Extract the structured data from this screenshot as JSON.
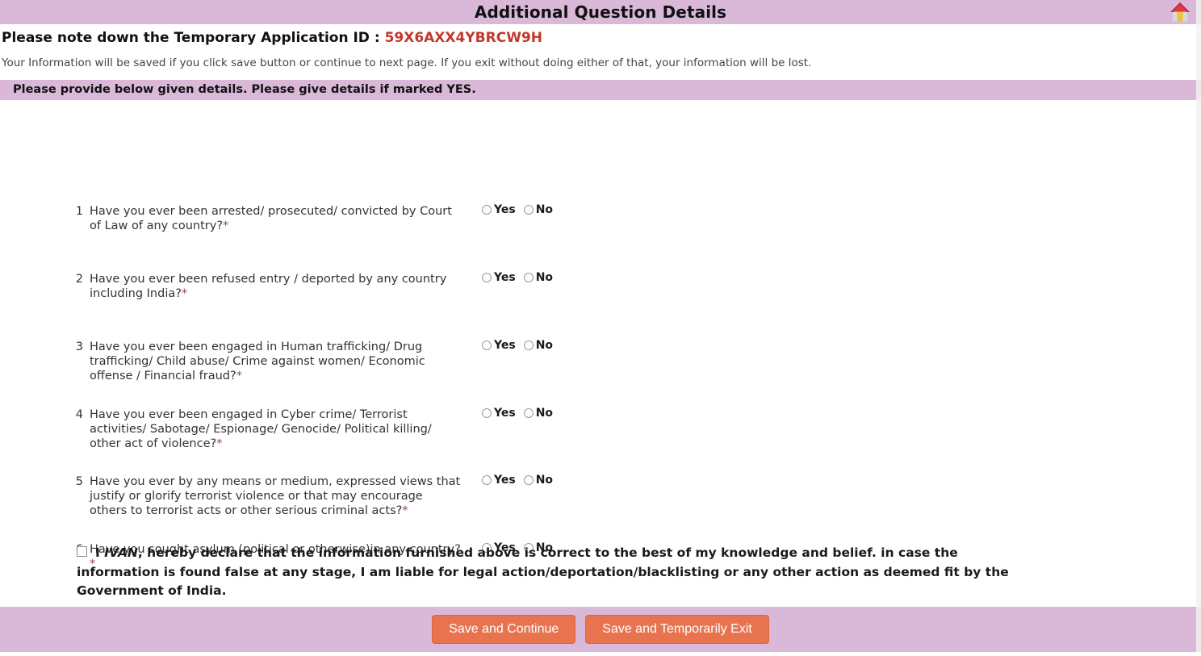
{
  "header": {
    "title": "Additional Question Details",
    "home_icon": "home-icon"
  },
  "application": {
    "note_label": "Please note down the Temporary Application ID : ",
    "temporary_application_id": "59X6AXX4YBRCW9H",
    "id_color": "#c0392b"
  },
  "info_note": "Your Information will be saved if you click save button or continue to next page. If you exit without doing either of that, your information will be lost.",
  "section_bar": {
    "text": "Please provide below given details. Please give details if marked YES."
  },
  "options": {
    "yes_label": "Yes",
    "no_label": "No"
  },
  "questions": [
    {
      "number": "1",
      "text": "Have you ever been arrested/ prosecuted/ convicted by Court of Law of any country?",
      "required_marker": "*",
      "selected": ""
    },
    {
      "number": "2",
      "text": "Have you ever been refused entry / deported by any country including India?",
      "required_marker": "*",
      "selected": ""
    },
    {
      "number": "3",
      "text": "Have you ever been engaged in Human trafficking/ Drug trafficking/ Child abuse/ Crime against women/ Economic offense / Financial fraud?",
      "required_marker": "*",
      "selected": ""
    },
    {
      "number": "4",
      "text": "Have you ever been engaged in Cyber crime/ Terrorist activities/ Sabotage/ Espionage/ Genocide/ Political killing/ other act of violence?",
      "required_marker": "*",
      "selected": ""
    },
    {
      "number": "5",
      "text": "Have you ever by any means or medium, expressed views that justify or glorify terrorist violence or that may encourage others to terrorist acts or other serious criminal acts?",
      "required_marker": "*",
      "selected": ""
    },
    {
      "number": "6",
      "text": "Have you sought asylum (political or otherwise)in any country?",
      "required_marker": "*",
      "selected": ""
    }
  ],
  "declaration": {
    "checked": false,
    "prefix": "I ",
    "applicant_name": "IVAN",
    "body": ", hereby declare that the information furnished above is correct to the best of my knowledge and belief. in case the information is found false at any stage, I am liable for legal action/deportation/blacklisting or any other action as deemed fit by the Government of India."
  },
  "footer": {
    "save_continue_label": "Save and Continue",
    "save_exit_label": "Save and Temporarily Exit",
    "button_color": "#e8744f",
    "bar_color": "#d9b8d8"
  }
}
